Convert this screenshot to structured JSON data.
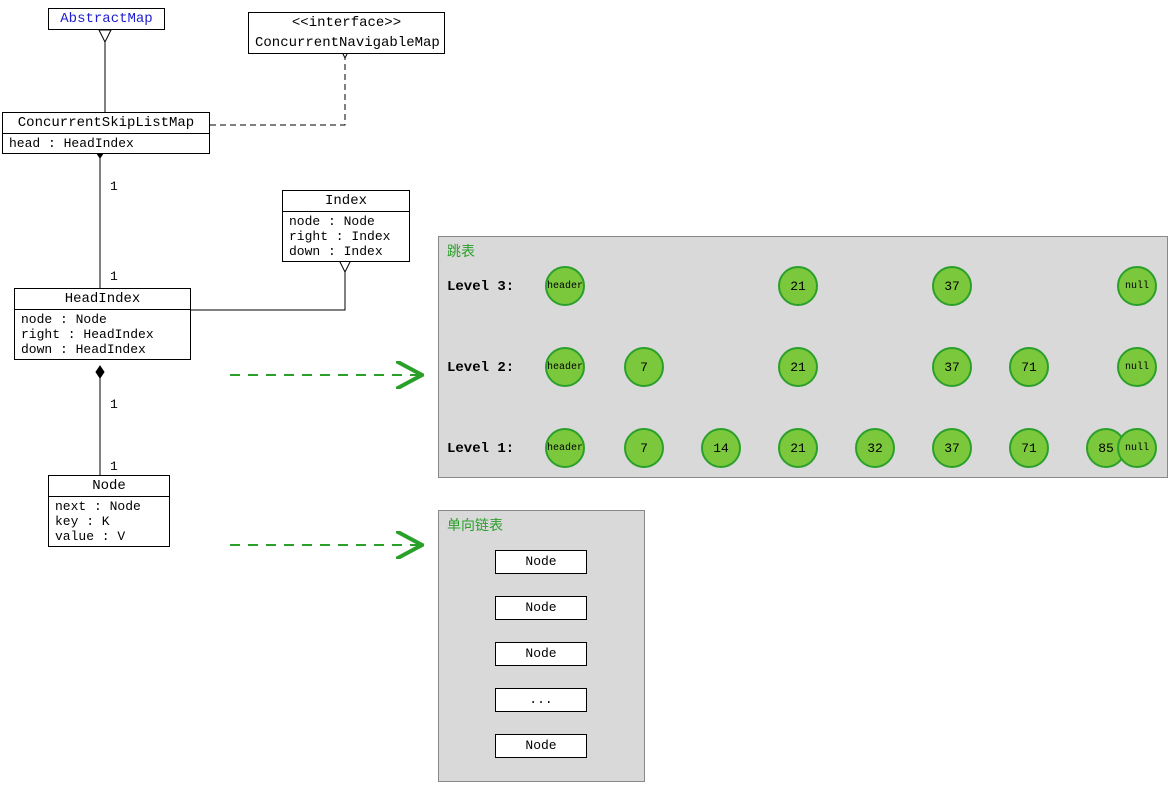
{
  "uml": {
    "abstractMap": {
      "name": "AbstractMap"
    },
    "interface": {
      "stereotype": "<<interface>>",
      "name": "ConcurrentNavigableMap"
    },
    "cslm": {
      "name": "ConcurrentSkipListMap",
      "field1": "head : HeadIndex"
    },
    "index": {
      "name": "Index",
      "f1": "node : Node",
      "f2": "right : Index",
      "f3": "down : Index"
    },
    "headIndex": {
      "name": "HeadIndex",
      "f1": "node : Node",
      "f2": "right : HeadIndex",
      "f3": "down : HeadIndex"
    },
    "node": {
      "name": "Node",
      "f1": "next : Node",
      "f2": "key : K",
      "f3": "value : V"
    },
    "multiplicity": "1"
  },
  "skiplist": {
    "title": "跳表",
    "level3": "Level 3:",
    "level2": "Level 2:",
    "level1": "Level 1:",
    "header": "header",
    "null": "null",
    "values": {
      "l1": [
        "header",
        "7",
        "14",
        "21",
        "32",
        "37",
        "71",
        "85",
        "null"
      ],
      "l2": [
        "header",
        "7",
        "21",
        "37",
        "71",
        "null"
      ],
      "l3": [
        "header",
        "21",
        "37",
        "null"
      ]
    }
  },
  "linkedlist": {
    "title": "单向链表",
    "node": "Node",
    "dots": "..."
  }
}
